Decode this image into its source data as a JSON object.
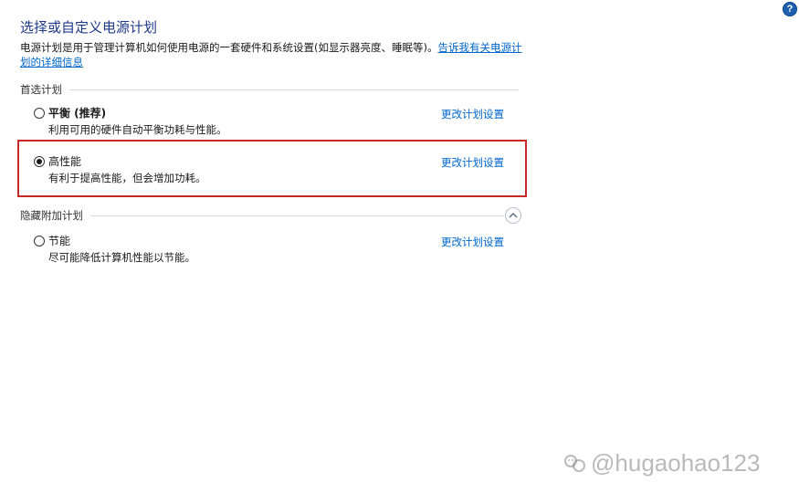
{
  "help": {
    "label": "?"
  },
  "header": {
    "title": "选择或自定义电源计划",
    "description": "电源计划是用于管理计算机如何使用电源的一套硬件和系统设置(如显示器亮度、睡眠等)。",
    "learn_more_link": "告诉我有关电源计划的详细信息"
  },
  "preferred_group": {
    "label": "首选计划",
    "plans": [
      {
        "name": "平衡 (推荐)",
        "description": "利用可用的硬件自动平衡功耗与性能。",
        "link": "更改计划设置",
        "selected": false
      },
      {
        "name": "高性能",
        "description": "有利于提高性能，但会增加功耗。",
        "link": "更改计划设置",
        "selected": true
      }
    ]
  },
  "hidden_group": {
    "label": "隐藏附加计划",
    "plans": [
      {
        "name": "节能",
        "description": "尽可能降低计算机性能以节能。",
        "link": "更改计划设置",
        "selected": false
      }
    ]
  },
  "watermark": {
    "text": "@hugaohao123"
  },
  "colors": {
    "title": "#1e3a8a",
    "link": "#0066cc",
    "highlight": "#c62828",
    "help": "#1f5fb0"
  }
}
